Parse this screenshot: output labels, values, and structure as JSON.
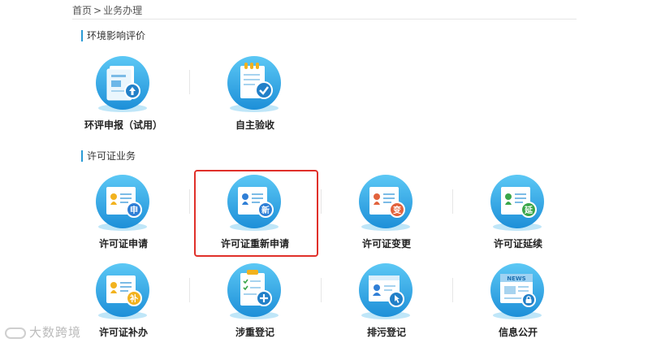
{
  "breadcrumb": {
    "home": "首页",
    "separator": ">",
    "current": "业务办理"
  },
  "sections": {
    "env": {
      "title": "环境影响评价"
    },
    "permit": {
      "title": "许可证业务"
    }
  },
  "tiles": {
    "env_report": {
      "label": "环评申报（试用）",
      "icon": "document-upload-icon"
    },
    "self_accept": {
      "label": "自主验收",
      "icon": "clipboard-check-icon"
    },
    "permit_apply": {
      "label": "许可证申请",
      "icon": "certificate-icon",
      "badge": "申"
    },
    "permit_reapply": {
      "label": "许可证重新申请",
      "icon": "certificate-icon",
      "badge": "新"
    },
    "permit_change": {
      "label": "许可证变更",
      "icon": "certificate-icon",
      "badge": "变"
    },
    "permit_extend": {
      "label": "许可证延续",
      "icon": "certificate-icon",
      "badge": "延"
    },
    "permit_supplement": {
      "label": "许可证补办",
      "icon": "certificate-icon",
      "badge": "补"
    },
    "heavy_register": {
      "label": "涉重登记",
      "icon": "checklist-add-icon"
    },
    "pollution_register": {
      "label": "排污登记",
      "icon": "id-card-pointer-icon"
    },
    "info_public": {
      "label": "信息公开",
      "icon": "newspaper-icon",
      "news": "NEWS"
    }
  },
  "watermark": {
    "text": "大数跨境"
  },
  "colors": {
    "accent": "#2a9bd6",
    "badge_apply": "#2f7fd6",
    "badge_new": "#2f7fd6",
    "badge_change": "#e2623c",
    "badge_extend": "#3aa64a",
    "badge_supplement": "#f2b21e",
    "highlight": "#e0302a"
  }
}
